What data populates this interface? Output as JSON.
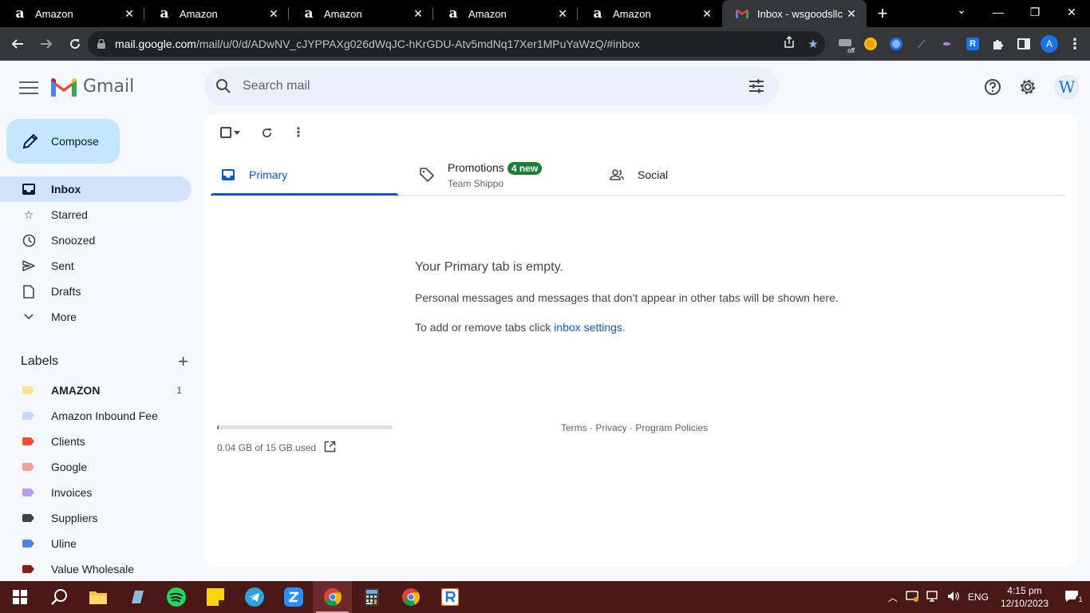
{
  "browser": {
    "tabs": [
      {
        "title": "Amazon",
        "favicon": "amazon-a"
      },
      {
        "title": "Amazon",
        "favicon": "amazon-a"
      },
      {
        "title": "Amazon",
        "favicon": "amazon-a"
      },
      {
        "title": "Amazon",
        "favicon": "amazon-a"
      },
      {
        "title": "Amazon",
        "favicon": "amazon-a"
      },
      {
        "title": "Inbox - wsgoodsllc@",
        "favicon": "gmail-m",
        "active": true
      }
    ],
    "url_host": "mail.google.com",
    "url_path": "/mail/u/0/d/ADwNV_cJYPPAXg026dWqJC-hKrGDU-Atv5mdNq17Xer1MPuYaWzQ/#inbox",
    "profile_initial": "A",
    "ext_badge": "off"
  },
  "gmail": {
    "app_name": "Gmail",
    "search_placeholder": "Search mail",
    "avatar_letter": "W",
    "compose_label": "Compose",
    "nav": [
      {
        "label": "Inbox",
        "icon": "inbox-icon",
        "active": true
      },
      {
        "label": "Starred",
        "icon": "star-icon"
      },
      {
        "label": "Snoozed",
        "icon": "clock-icon"
      },
      {
        "label": "Sent",
        "icon": "send-icon"
      },
      {
        "label": "Drafts",
        "icon": "draft-icon"
      },
      {
        "label": "More",
        "icon": "chevron-down-icon"
      }
    ],
    "labels_heading": "Labels",
    "labels": [
      {
        "name": "AMAZON",
        "color": "#fde293",
        "count": "1",
        "bold": true
      },
      {
        "name": "Amazon Inbound Fee",
        "color": "#c6dafc"
      },
      {
        "name": "Clients",
        "color": "#fb4c2f"
      },
      {
        "name": "Google",
        "color": "#efa093"
      },
      {
        "name": "Invoices",
        "color": "#b99aff"
      },
      {
        "name": "Suppliers",
        "color": "#434343"
      },
      {
        "name": "Uline",
        "color": "#4a86e8"
      },
      {
        "name": "Value Wholesale",
        "color": "#822111"
      }
    ],
    "tabs": {
      "primary": "Primary",
      "promotions": "Promotions",
      "promotions_badge": "4 new",
      "promotions_sub": "Team Shippo",
      "social": "Social"
    },
    "empty": {
      "title": "Your Primary tab is empty.",
      "line1": "Personal messages and messages that don’t appear in other tabs will be shown here.",
      "line2_prefix": "To add or remove tabs click ",
      "line2_link": "inbox settings",
      "line2_suffix": "."
    },
    "storage": {
      "text": "0.04 GB of 15 GB used",
      "fraction": 0.003
    },
    "footer": "Terms · Privacy · Program Policies",
    "colors": {
      "accent": "#0b57d0",
      "compose": "#c2e7ff",
      "active_nav": "#d3e3fd"
    }
  },
  "taskbar": {
    "lang": "ENG",
    "time": "4:15 pm",
    "date": "12/10/2023",
    "notif_count": "1"
  }
}
